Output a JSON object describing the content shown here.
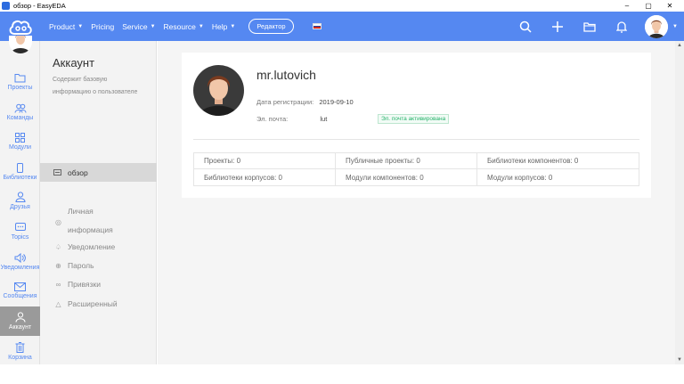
{
  "window": {
    "title": "обзор - EasyEDA",
    "controls": [
      "–",
      "▢",
      "✕"
    ]
  },
  "nav": {
    "items": [
      {
        "label": "Product",
        "dropdown": true
      },
      {
        "label": "Pricing",
        "dropdown": false
      },
      {
        "label": "Service",
        "dropdown": true
      },
      {
        "label": "Resource",
        "dropdown": true
      },
      {
        "label": "Help",
        "dropdown": true
      }
    ],
    "editor_label": "Редактор",
    "caret": "▼",
    "brand_color": "#5588f1"
  },
  "rail": {
    "items": [
      {
        "label": "Проекты",
        "icon": "folder-icon"
      },
      {
        "label": "Команды",
        "icon": "team-icon"
      },
      {
        "label": "Модули",
        "icon": "modules-icon"
      },
      {
        "label": "Библиотеки",
        "icon": "library-icon"
      },
      {
        "label": "Друзья",
        "icon": "friends-icon"
      },
      {
        "label": "Topics",
        "icon": "topics-icon"
      },
      {
        "label": "Уведомления",
        "icon": "notification-icon"
      },
      {
        "label": "Сообщения",
        "icon": "message-icon"
      },
      {
        "label": "Аккаунт",
        "icon": "user-icon",
        "active": true
      },
      {
        "label": "Корзина",
        "icon": "trash-icon"
      }
    ]
  },
  "sidebar": {
    "title": "Аккаунт",
    "description": "Содержит базовую информацию о пользователе",
    "active_item": {
      "label": "обзор",
      "icon": "overview-icon"
    },
    "items": [
      {
        "label": "Личная информация",
        "icon": "personal-icon"
      },
      {
        "label": "Уведомление",
        "icon": "bell-icon"
      },
      {
        "label": "Пароль",
        "icon": "lock-icon"
      },
      {
        "label": "Привязки",
        "icon": "link-icon"
      },
      {
        "label": "Расширенный",
        "icon": "warning-icon"
      }
    ]
  },
  "profile": {
    "username": "mr.lutovich",
    "reg_label": "Дата регистрации:",
    "reg_date": "2019-09-10",
    "email_label": "Эл. почта:",
    "email_value": "lut",
    "email_badge": "Эл. почта активирована",
    "badge_color": "#27b36b"
  },
  "stats": [
    {
      "label": "Проекты:",
      "value": "0"
    },
    {
      "label": "Публичные проекты:",
      "value": "0"
    },
    {
      "label": "Библиотеки компонентов:",
      "value": "0"
    },
    {
      "label": "Библиотеки корпусов:",
      "value": "0"
    },
    {
      "label": "Модули компонентов:",
      "value": "0"
    },
    {
      "label": "Модули корпусов:",
      "value": "0"
    }
  ]
}
